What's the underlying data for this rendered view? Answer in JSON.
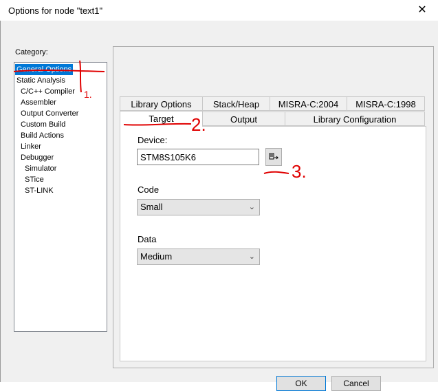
{
  "window": {
    "title": "Options for node \"text1\"",
    "close_glyph": "✕"
  },
  "category": {
    "label": "Category:",
    "items": [
      {
        "label": "General Options",
        "selected": true,
        "indent": 0
      },
      {
        "label": "Static Analysis",
        "indent": 0
      },
      {
        "label": "C/C++ Compiler",
        "indent": 1
      },
      {
        "label": "Assembler",
        "indent": 1
      },
      {
        "label": "Output Converter",
        "indent": 1
      },
      {
        "label": "Custom Build",
        "indent": 1
      },
      {
        "label": "Build Actions",
        "indent": 1
      },
      {
        "label": "Linker",
        "indent": 1
      },
      {
        "label": "Debugger",
        "indent": 1
      },
      {
        "label": "Simulator",
        "indent": 2
      },
      {
        "label": "STice",
        "indent": 2
      },
      {
        "label": "ST-LINK",
        "indent": 2
      }
    ]
  },
  "tabs": {
    "row_back": [
      "Library Options",
      "Stack/Heap",
      "MISRA-C:2004",
      "MISRA-C:1998"
    ],
    "row_front": [
      "Target",
      "Output",
      "Library Configuration"
    ],
    "active": "Target"
  },
  "target": {
    "device_label": "Device:",
    "device_value": "STM8S105K6",
    "code_label": "Code",
    "code_value": "Small",
    "data_label": "Data",
    "data_value": "Medium"
  },
  "buttons": {
    "ok": "OK",
    "cancel": "Cancel"
  },
  "annotations": {
    "n1": "1.",
    "n2": "2.",
    "n3": "3."
  },
  "colors": {
    "selection": "#0078d7",
    "annotation": "#e00000"
  }
}
